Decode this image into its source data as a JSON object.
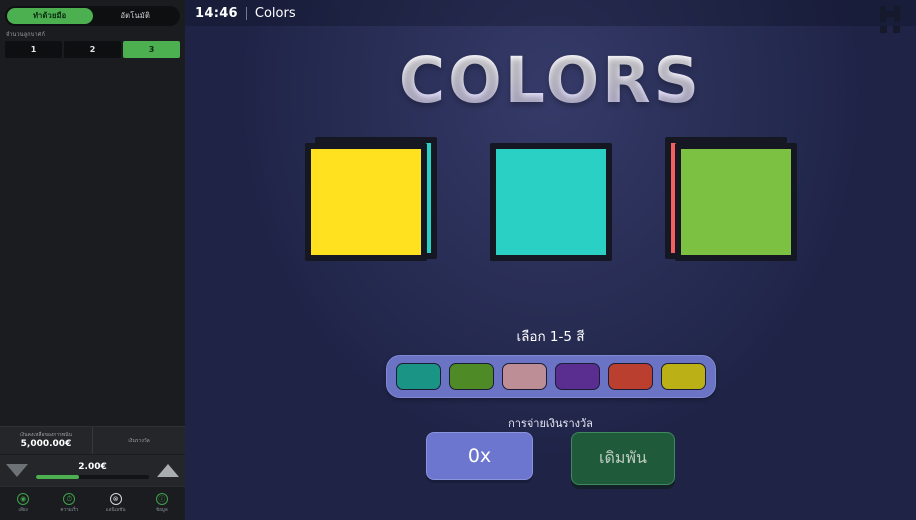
{
  "sidebar": {
    "mode_tabs": [
      {
        "label": "ทำด้วยมือ",
        "active": true
      },
      {
        "label": "อัตโนมัติ",
        "active": false
      }
    ],
    "count_label": "จำนวนลูกบาศก์",
    "count_buttons": [
      {
        "label": "1",
        "active": false
      },
      {
        "label": "2",
        "active": false
      },
      {
        "label": "3",
        "active": true
      }
    ],
    "balance": {
      "caption": "เงินคงเหลือของการพนัน",
      "value": "5,000.00€",
      "profit_caption": "เงินรางวัล"
    },
    "stake": {
      "value": "2.00€",
      "fill_percent": 38
    },
    "footer_icons": [
      {
        "icon": "volume-icon",
        "glyph": "◉",
        "label": "เสียง",
        "muted": false
      },
      {
        "icon": "speed-icon",
        "glyph": "⏱",
        "label": "ความเร็ว",
        "muted": false
      },
      {
        "icon": "no-animation-icon",
        "glyph": "⊗",
        "label": "แอนิเมชัน",
        "muted": true
      },
      {
        "icon": "info-icon",
        "glyph": "ⓘ",
        "label": "ข้อมูล",
        "muted": false
      }
    ]
  },
  "topbar": {
    "clock": "14:46",
    "separator": "|",
    "game_name": "Colors",
    "logo": "hacksaw-logo"
  },
  "main": {
    "title": "COLORS",
    "cards": [
      {
        "front": "#ffe11f",
        "back": "#2ad0c4",
        "back_side": "right"
      },
      {
        "front": "#2ad0c4",
        "back": null,
        "back_side": "none"
      },
      {
        "front": "#7cc142",
        "back": "#f4615c",
        "back_side": "left"
      }
    ],
    "prompt": "เลือก 1-5 สี",
    "palette": [
      {
        "name": "swatch-teal",
        "color": "#1a9484"
      },
      {
        "name": "swatch-green",
        "color": "#4e8b26"
      },
      {
        "name": "swatch-pink",
        "color": "#bd8e96"
      },
      {
        "name": "swatch-purple",
        "color": "#5a2d91"
      },
      {
        "name": "swatch-red",
        "color": "#bb3f2e"
      },
      {
        "name": "swatch-yellow",
        "color": "#bbb117"
      }
    ],
    "payout_label": "การจ่ายเงินรางวัล",
    "payout_value": "0x",
    "bet_button": "เดิมพัน"
  },
  "colors": {
    "accent_green": "#4caf50",
    "panel_blue": "#6a73c4",
    "background_navy": "#1f2447"
  }
}
